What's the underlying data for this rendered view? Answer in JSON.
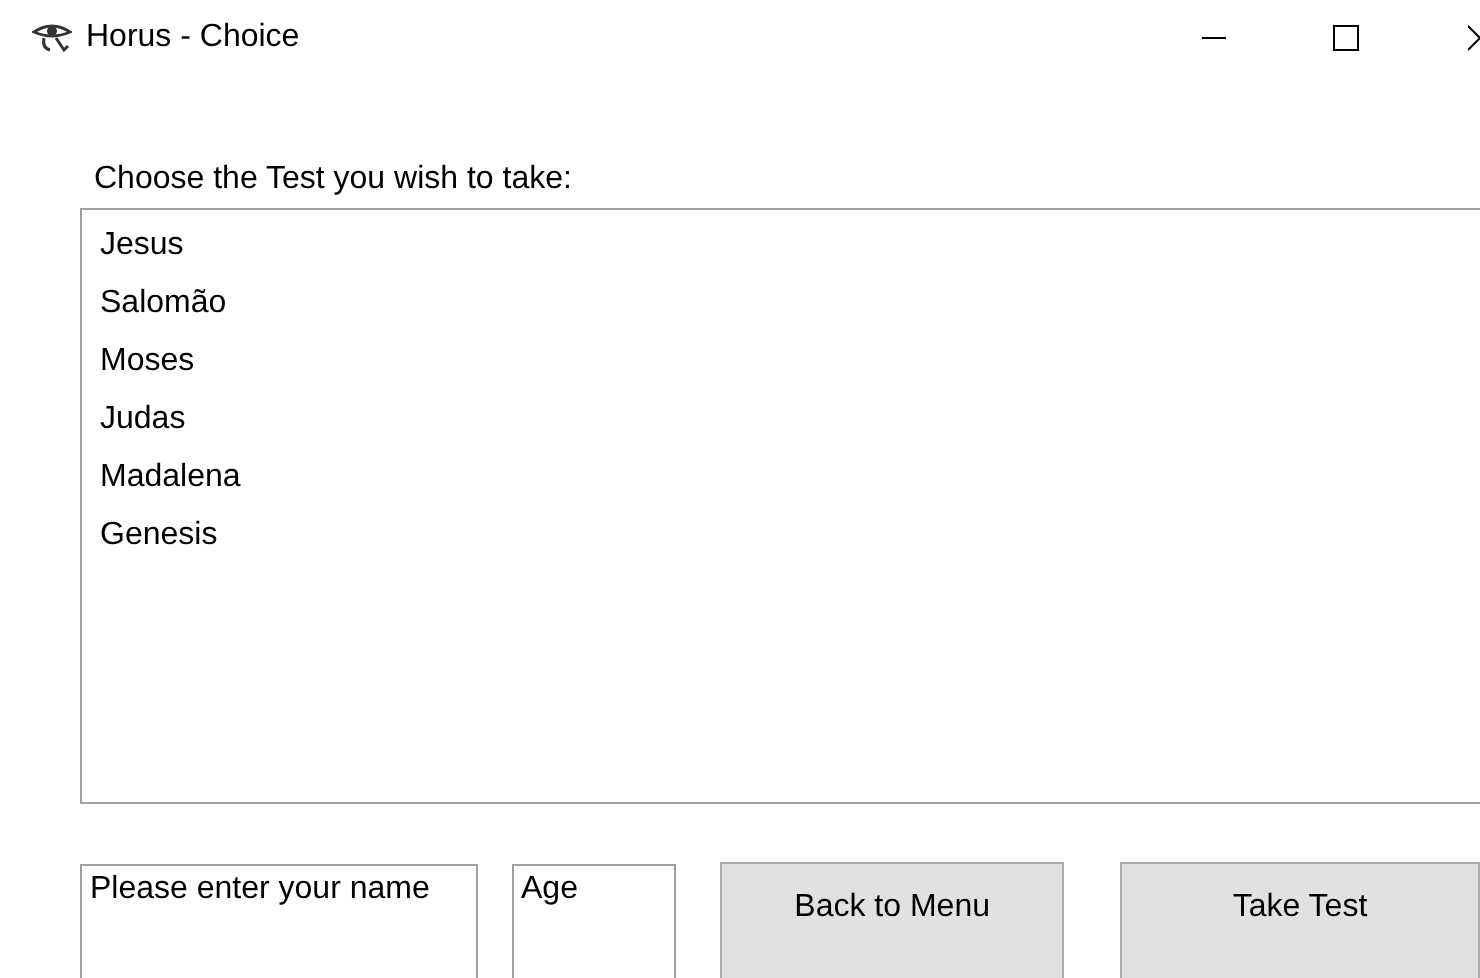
{
  "window": {
    "title": "Horus - Choice"
  },
  "prompt": "Choose the Test you wish to take:",
  "tests": [
    {
      "label": "Jesus",
      "selected": false
    },
    {
      "label": "Salomão",
      "selected": false
    },
    {
      "label": "Moses",
      "selected": false
    },
    {
      "label": "Judas",
      "selected": false
    },
    {
      "label": "Madalena",
      "selected": false
    },
    {
      "label": "Genesis",
      "selected": false
    }
  ],
  "name_field": {
    "value": "Please enter your name"
  },
  "age_field": {
    "value": "Age"
  },
  "buttons": [
    "Back to Menu",
    "Take Test"
  ]
}
